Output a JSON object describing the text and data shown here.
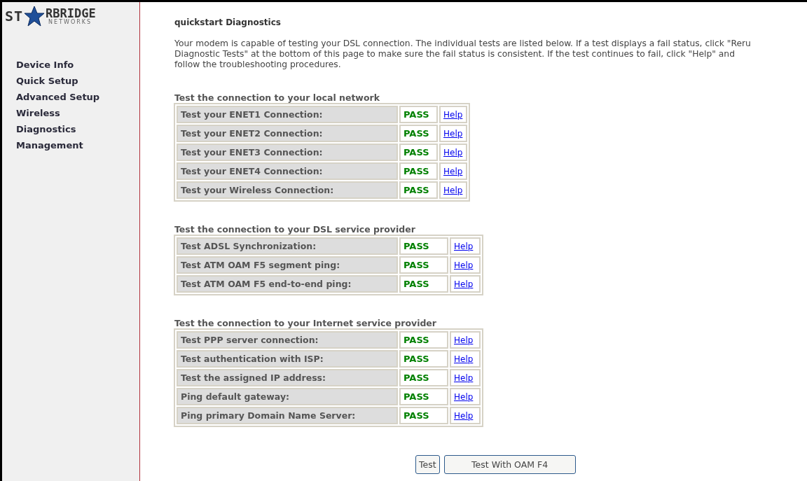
{
  "logo": {
    "left": "ST",
    "right": "RBRIDGE",
    "tagline": "NETWORKS"
  },
  "sidebar": {
    "items": [
      {
        "label": "Device Info"
      },
      {
        "label": "Quick Setup"
      },
      {
        "label": "Advanced Setup"
      },
      {
        "label": "Wireless"
      },
      {
        "label": "Diagnostics"
      },
      {
        "label": "Management"
      }
    ]
  },
  "title": "quickstart Diagnostics",
  "intro_lines": [
    "Your modem is capable of testing your DSL connection. The individual tests are listed below. If a test displays a fail status, click \"Reru",
    "Diagnostic Tests\" at the bottom of this page to make sure the fail status is consistent. If the test continues to fail, click \"Help\" and",
    "follow the troubleshooting procedures."
  ],
  "sections": [
    {
      "title": "Test the connection to your local network",
      "kind": "narrow",
      "rows": [
        {
          "label": "Test your ENET1 Connection:",
          "status": "PASS",
          "help": "Help"
        },
        {
          "label": "Test your ENET2 Connection:",
          "status": "PASS",
          "help": "Help"
        },
        {
          "label": "Test your ENET3 Connection:",
          "status": "PASS",
          "help": "Help"
        },
        {
          "label": "Test your ENET4 Connection:",
          "status": "PASS",
          "help": "Help"
        },
        {
          "label": "Test your Wireless Connection:",
          "status": "PASS",
          "help": "Help"
        }
      ]
    },
    {
      "title": "Test the connection to your DSL service provider",
      "kind": "wide",
      "rows": [
        {
          "label": "Test ADSL Synchronization:",
          "status": "PASS",
          "help": "Help"
        },
        {
          "label": "Test ATM OAM F5 segment ping:",
          "status": "PASS",
          "help": "Help"
        },
        {
          "label": "Test ATM OAM F5 end-to-end ping:",
          "status": "PASS",
          "help": "Help"
        }
      ]
    },
    {
      "title": "Test the connection to your Internet service provider",
      "kind": "wide",
      "rows": [
        {
          "label": "Test PPP server connection:",
          "status": "PASS",
          "help": "Help"
        },
        {
          "label": "Test authentication with ISP:",
          "status": "PASS",
          "help": "Help"
        },
        {
          "label": "Test the assigned IP address:",
          "status": "PASS",
          "help": "Help"
        },
        {
          "label": "Ping default gateway:",
          "status": "PASS",
          "help": "Help"
        },
        {
          "label": "Ping primary Domain Name Server:",
          "status": "PASS",
          "help": "Help"
        }
      ]
    }
  ],
  "buttons": [
    {
      "label": "Test",
      "kind": "short"
    },
    {
      "label": "Test With OAM F4",
      "kind": "long"
    }
  ]
}
